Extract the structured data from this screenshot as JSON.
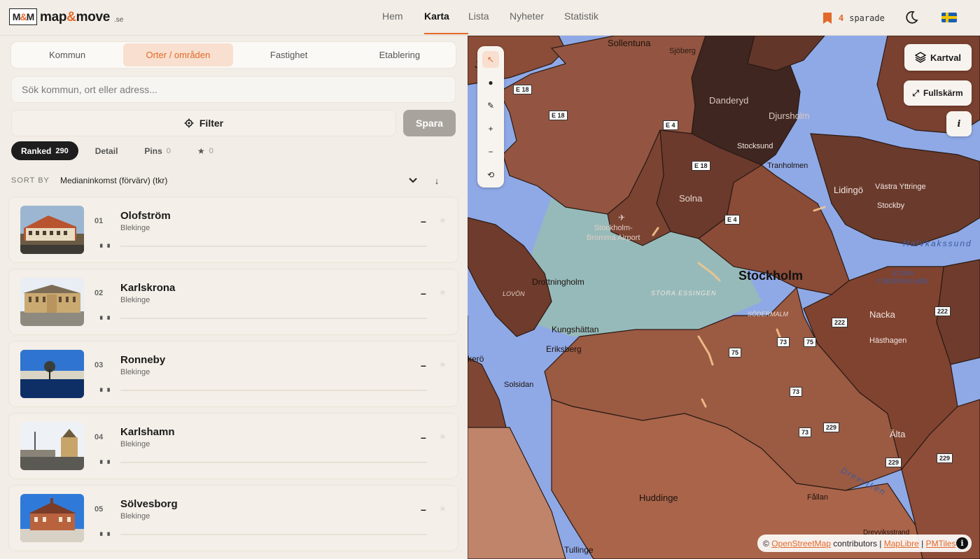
{
  "header": {
    "logo_mark_left": "M",
    "logo_mark_mid": "&",
    "logo_mark_right": "M",
    "logo_word1": "map",
    "logo_amp": "&",
    "logo_word2": "move",
    "logo_tld": ".se",
    "nav": [
      {
        "label": "Hem",
        "active": false
      },
      {
        "label": "Karta",
        "active": true
      },
      {
        "label": "Lista",
        "active": false
      },
      {
        "label": "Nyheter",
        "active": false
      },
      {
        "label": "Statistik",
        "active": false
      }
    ],
    "saved_count": "4",
    "saved_label": "sparade",
    "icons": {
      "saved": "bookmark-icon",
      "theme": "moon-icon",
      "language": "swedish-flag-icon"
    }
  },
  "panel": {
    "tabs": [
      "Kommun",
      "Orter / områden",
      "Fastighet",
      "Etablering"
    ],
    "active_tab": 1,
    "search_placeholder": "Sök kommun, ort eller adress...",
    "filter_label": "Filter",
    "save_label": "Spara",
    "subtabs": [
      {
        "label": "Ranked",
        "count": "290",
        "active": true
      },
      {
        "label": "Detail",
        "count": "",
        "active": false
      },
      {
        "label": "Pins",
        "count": "0",
        "active": false
      },
      {
        "label": "★",
        "count": "0",
        "active": false
      }
    ],
    "sort_label": "SORT BY",
    "sort_value": "Medianinkomst (förvärv) (tkr)",
    "sort_direction_icon": "arrow-down-icon",
    "items": [
      {
        "rank": "01",
        "name": "Olofström",
        "region": "Blekinge",
        "value": "–"
      },
      {
        "rank": "02",
        "name": "Karlskrona",
        "region": "Blekinge",
        "value": "–"
      },
      {
        "rank": "03",
        "name": "Ronneby",
        "region": "Blekinge",
        "value": "–"
      },
      {
        "rank": "04",
        "name": "Karlshamn",
        "region": "Blekinge",
        "value": "–"
      },
      {
        "rank": "05",
        "name": "Sölvesborg",
        "region": "Blekinge",
        "value": "–"
      }
    ]
  },
  "map": {
    "tools": [
      "select-icon",
      "pin-icon",
      "draw-icon",
      "zoom-in-icon",
      "zoom-out-icon",
      "reset-icon"
    ],
    "tool_glyphs": [
      "↖",
      "●",
      "✎",
      "+",
      "−",
      "⟲"
    ],
    "kartval_label": "Kartval",
    "fullscreen_label": "Fullskärm",
    "info_label": "i",
    "labels": {
      "sollentuna": "Sollentuna",
      "sjoberg": "Sjöberg",
      "danderyd": "Danderyd",
      "djursholm": "Djursholm",
      "stocksund": "Stocksund",
      "tranholmen": "Tranholmen",
      "lidingo": "Lidingö",
      "vastra_yttringe": "Västra Yttringe",
      "stockby": "Stockby",
      "halvkakssund": "Halvkakssund",
      "solna": "Solna",
      "bromma": "Stockholm-\nBromma Airport",
      "stockholm": "Stockholm",
      "stora_fjaderholmen": "STORA\nFJÄDERHOLMEN",
      "drottningholm": "Drottningholm",
      "lovon": "LOVÖN",
      "stora_essingen": "STORA ESSINGEN",
      "sodermalm": "SÖDERMALM",
      "nacka": "Nacka",
      "hasthagen": "Hästhagen",
      "kungshattan": "Kungshättan",
      "eriksberg": "Eriksberg",
      "kero": "kerö",
      "solsidan": "Solsidan",
      "alta": "Älta",
      "huddinge": "Huddinge",
      "fallan": "Fållan",
      "drevviken": "Drevviken",
      "drevviksstrand": "Drevviksstrand",
      "tullinge": "Tullinge",
      "j": "J"
    },
    "shields": [
      "E 18",
      "E 18",
      "E 4",
      "E 18",
      "E 4",
      "222",
      "222",
      "73",
      "75",
      "75",
      "73",
      "73",
      "229",
      "229",
      "229"
    ],
    "attribution_prefix": "©",
    "attribution_osm": "OpenStreetMap",
    "attribution_mid": "contributors |",
    "attribution_maplibre": "MapLibre",
    "attribution_sep": "|",
    "attribution_pmtiles": "PMTiles",
    "attribution_info": "i"
  },
  "colors": {
    "accent": "#e2692a",
    "water": "#8fa9e6",
    "region_dark": "#4a2a20",
    "region_mid": "#8b4a36",
    "region_light": "#b06e52"
  }
}
